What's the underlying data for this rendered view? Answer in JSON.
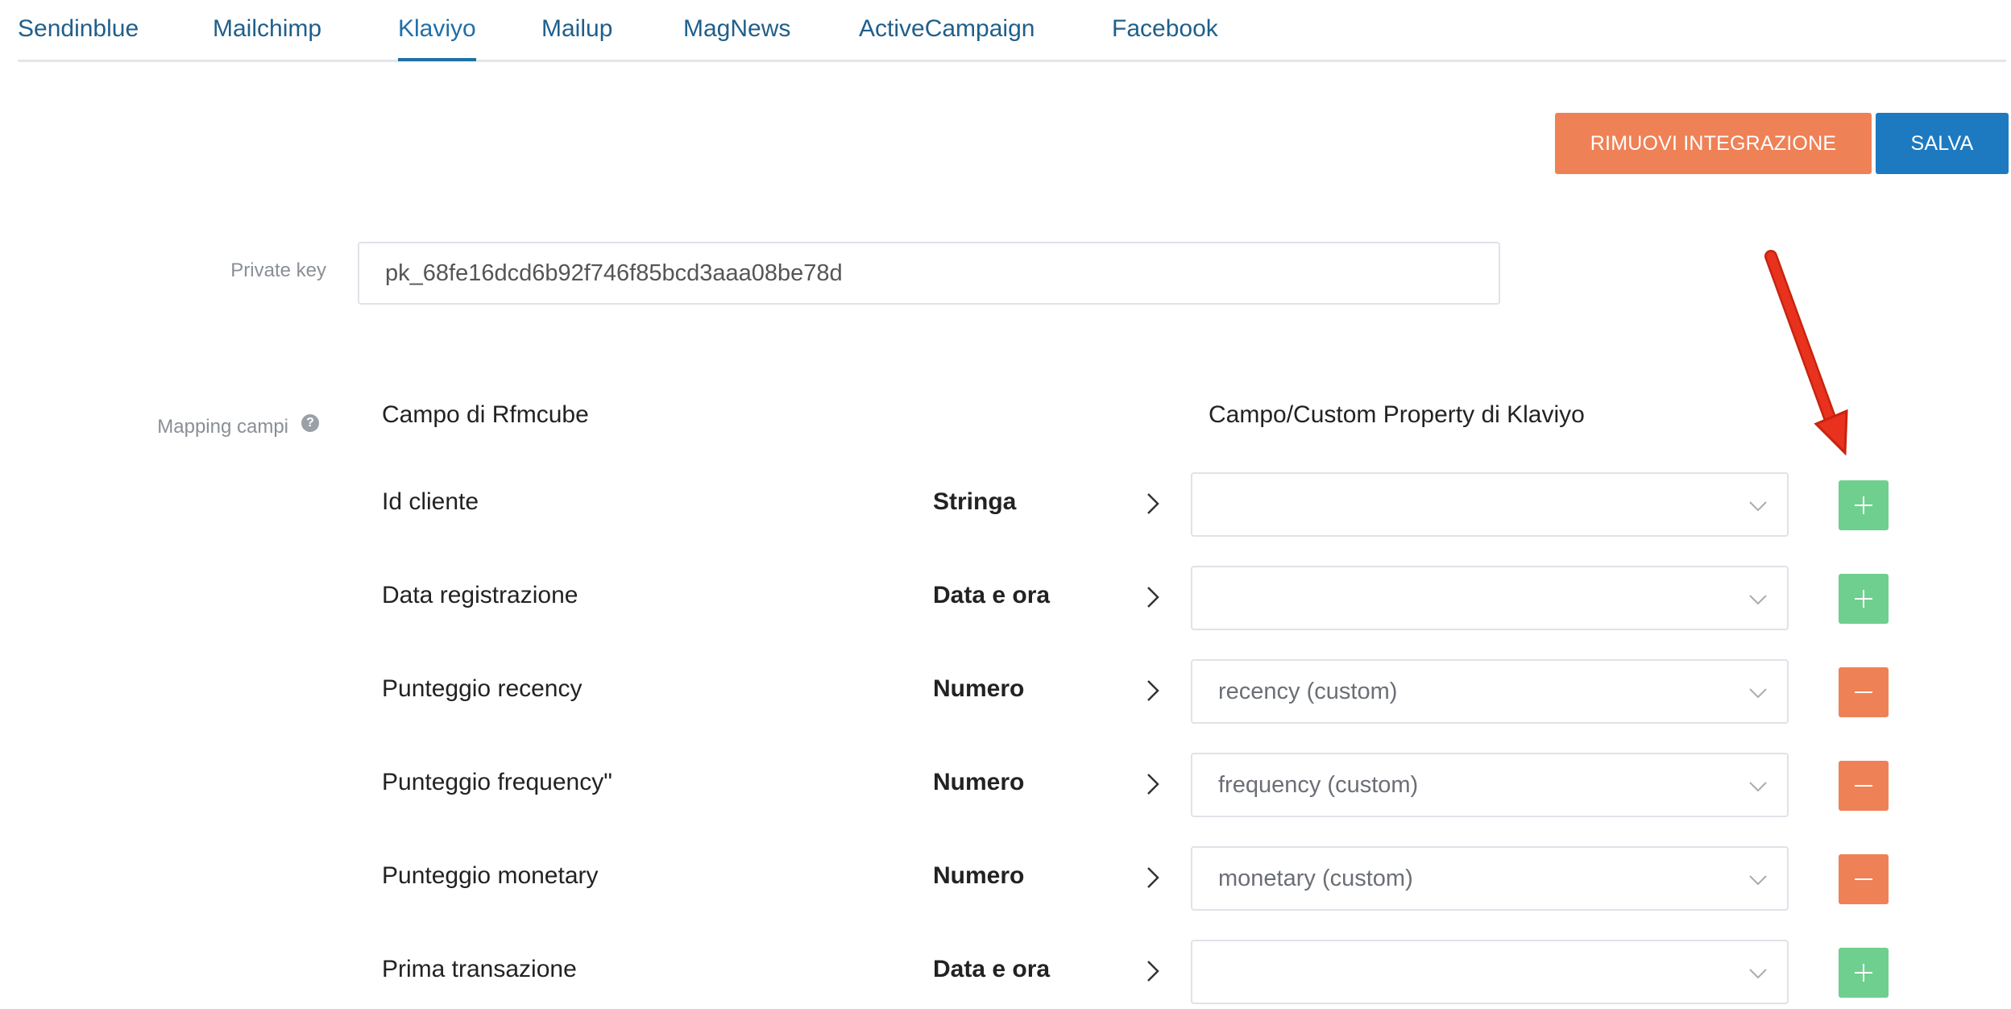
{
  "tabs": [
    {
      "label": "Sendinblue"
    },
    {
      "label": "Mailchimp"
    },
    {
      "label": "Klaviyo"
    },
    {
      "label": "Mailup"
    },
    {
      "label": "MagNews"
    },
    {
      "label": "ActiveCampaign"
    },
    {
      "label": "Facebook"
    }
  ],
  "active_tab": "Klaviyo",
  "actions": {
    "remove_label": "RIMUOVI INTEGRAZIONE",
    "save_label": "SALVA"
  },
  "private_key": {
    "label": "Private key",
    "value": "pk_68fe16dcd6b92f746f85bcd3aaa08be78d"
  },
  "mapping": {
    "label": "Mapping campi",
    "col_left": "Campo di Rfmcube",
    "col_right": "Campo/Custom Property di Klaviyo",
    "rows": [
      {
        "field": "Id cliente",
        "type": "Stringa",
        "value": "",
        "action": "add"
      },
      {
        "field": "Data registrazione",
        "type": "Data e ora",
        "value": "",
        "action": "add"
      },
      {
        "field": "Punteggio recency",
        "type": "Numero",
        "value": "recency (custom)",
        "action": "remove"
      },
      {
        "field": "Punteggio frequency\"",
        "type": "Numero",
        "value": "frequency (custom)",
        "action": "remove"
      },
      {
        "field": "Punteggio monetary",
        "type": "Numero",
        "value": "monetary (custom)",
        "action": "remove"
      },
      {
        "field": "Prima transazione",
        "type": "Data e ora",
        "value": "",
        "action": "add"
      }
    ]
  },
  "colors": {
    "tab_text": "#1f5f8b",
    "remove_button": "#ef8156",
    "save_button": "#1e7ac0",
    "add_row_button": "#6fcf8f",
    "arrow_annotation": "#e8321e"
  }
}
